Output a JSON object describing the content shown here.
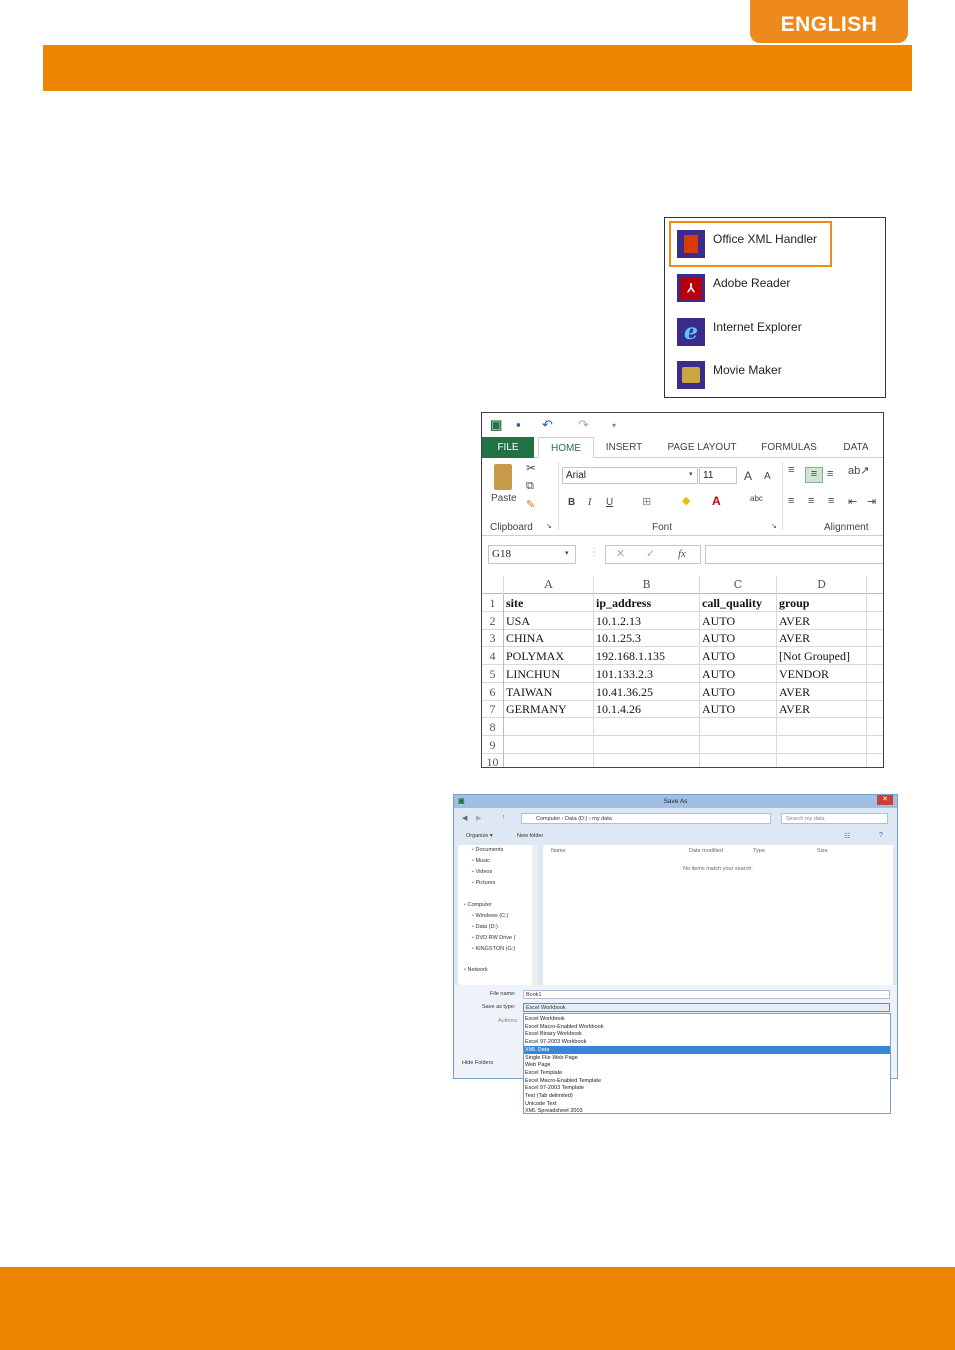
{
  "header": {
    "language_tab": "ENGLISH"
  },
  "open_with": {
    "items": [
      {
        "label": "Office XML Handler",
        "icon": "office-icon",
        "color": "#d83b01"
      },
      {
        "label": "Adobe Reader",
        "icon": "pdf-icon",
        "color": "#b3000c"
      },
      {
        "label": "Internet Explorer",
        "icon": "ie-icon",
        "color": "#1a8ad8"
      },
      {
        "label": "Movie Maker",
        "icon": "movie-maker-icon",
        "color": "#7a6a2e"
      }
    ]
  },
  "excel": {
    "tabs": [
      "FILE",
      "HOME",
      "INSERT",
      "PAGE LAYOUT",
      "FORMULAS",
      "DATA"
    ],
    "ribbon": {
      "paste": "Paste",
      "font_name": "Arial",
      "font_size": "11",
      "grow_font": "A",
      "shrink_font": "A",
      "bold": "B",
      "italic": "I",
      "underline": "U",
      "clipboard_group": "Clipboard",
      "font_group": "Font",
      "alignment_group": "Alignment"
    },
    "name_box": "G18",
    "fx": "fx",
    "columns": [
      "A",
      "B",
      "C",
      "D"
    ],
    "rows": [
      {
        "n": "1",
        "cells": [
          "site",
          "ip_address",
          "call_quality",
          "group"
        ]
      },
      {
        "n": "2",
        "cells": [
          "USA",
          "10.1.2.13",
          "AUTO",
          "AVER"
        ]
      },
      {
        "n": "3",
        "cells": [
          "CHINA",
          "10.1.25.3",
          "AUTO",
          "AVER"
        ]
      },
      {
        "n": "4",
        "cells": [
          "POLYMAX",
          "192.168.1.135",
          "AUTO",
          "[Not Grouped]"
        ]
      },
      {
        "n": "5",
        "cells": [
          "LINCHUN",
          "101.133.2.3",
          "AUTO",
          "VENDOR"
        ]
      },
      {
        "n": "6",
        "cells": [
          "TAIWAN",
          "10.41.36.25",
          "AUTO",
          "AVER"
        ]
      },
      {
        "n": "7",
        "cells": [
          "GERMANY",
          "10.1.4.26",
          "AUTO",
          "AVER"
        ]
      },
      {
        "n": "8",
        "cells": [
          "",
          "",
          "",
          ""
        ]
      },
      {
        "n": "9",
        "cells": [
          "",
          "",
          "",
          ""
        ]
      },
      {
        "n": "10",
        "cells": [
          "",
          "",
          "",
          ""
        ]
      }
    ]
  },
  "save_as": {
    "title": "Save As",
    "close": "✕",
    "address": [
      "Computer",
      "Data (D:)",
      "my data"
    ],
    "search_placeholder": "Search my data",
    "organize": "Organize ▾",
    "new_folder": "New folder",
    "nav": [
      {
        "label": "Documents",
        "icon": "documents-icon"
      },
      {
        "label": "Music",
        "icon": "music-icon"
      },
      {
        "label": "Videos",
        "icon": "videos-icon"
      },
      {
        "label": "Pictures",
        "icon": "pictures-icon"
      },
      {
        "label": "Computer",
        "icon": "computer-icon"
      },
      {
        "label": "Windows (C:)",
        "icon": "drive-icon"
      },
      {
        "label": "Data (D:)",
        "icon": "drive-icon"
      },
      {
        "label": "DVD RW Drive (",
        "icon": "dvd-icon"
      },
      {
        "label": "KINGSTON (G:)",
        "icon": "usb-drive-icon"
      },
      {
        "label": "Network",
        "icon": "network-icon"
      }
    ],
    "columns": [
      "Name",
      "Date modified",
      "Type",
      "Size"
    ],
    "empty_message": "No items match your search.",
    "file_name_label": "File name:",
    "file_name": "Book1",
    "save_type_label": "Save as type:",
    "save_type": "Excel Workbook",
    "authors_label": "Authors:",
    "hide_folders": "Hide Folders",
    "type_options": [
      "Excel Workbook",
      "Excel Macro-Enabled Workbook",
      "Excel Binary Workbook",
      "Excel 97-2003 Workbook",
      "XML Data",
      "Single File Web Page",
      "Web Page",
      "Excel Template",
      "Excel Macro-Enabled Template",
      "Excel 97-2003 Template",
      "Text (Tab delimited)",
      "Unicode Text",
      "XML Spreadsheet 2003"
    ],
    "selected_option": "XML Data"
  },
  "colors": {
    "brand_orange": "#ee8500",
    "excel_green": "#217346",
    "selection_blue": "#3a86d6"
  }
}
